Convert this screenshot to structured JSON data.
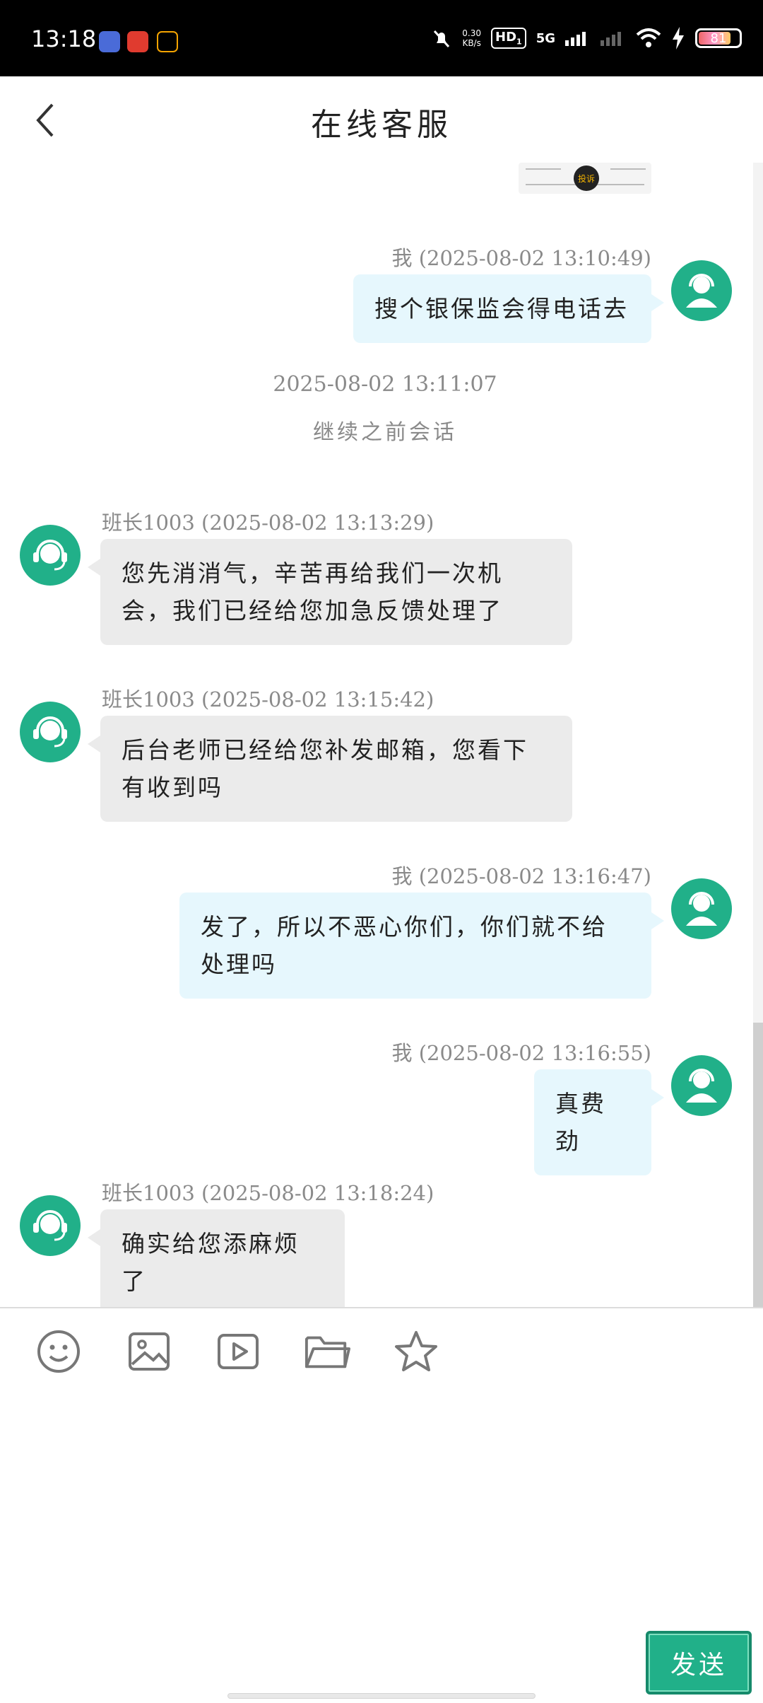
{
  "status_bar": {
    "time": "13:18",
    "net_speed_value": "0.30",
    "net_speed_unit": "KB/s",
    "hd_label": "HD",
    "hd_sub": "1",
    "network": "5G",
    "battery": "81"
  },
  "header": {
    "title": "在线客服",
    "back_icon": "chevron-left-icon"
  },
  "preview": {
    "button_label": "投诉"
  },
  "messages": [
    {
      "sender": "me",
      "meta": "我 (2025-08-02 13:10:49)",
      "text": [
        "搜个银保监会得电话去"
      ]
    },
    {
      "sender": "system",
      "timestamp": "2025-08-02 13:11:07",
      "note": "继续之前会话"
    },
    {
      "sender": "agent",
      "meta": "班长1003 (2025-08-02 13:13:29)",
      "text": [
        "您先消消气，辛苦再给我们一次机",
        "会，我们已经给您加急反馈处理了"
      ]
    },
    {
      "sender": "agent",
      "meta": "班长1003 (2025-08-02 13:15:42)",
      "text": [
        "后台老师已经给您补发邮箱，您看下",
        "有收到吗"
      ]
    },
    {
      "sender": "me",
      "meta": "我 (2025-08-02 13:16:47)",
      "text": [
        "发了，所以不恶心你们，你们就不给",
        "处理吗"
      ]
    },
    {
      "sender": "me",
      "meta": "我 (2025-08-02 13:16:55)",
      "text": [
        "真费劲"
      ]
    },
    {
      "sender": "agent",
      "meta": "班长1003 (2025-08-02 13:18:24)",
      "text": [
        "确实给您添麻烦了"
      ]
    }
  ],
  "toolbar": {
    "icons": [
      "emoji-icon",
      "image-icon",
      "video-icon",
      "folder-icon",
      "star-icon"
    ]
  },
  "send_button": {
    "label": "发送"
  },
  "colors": {
    "accent": "#21b089",
    "my_bubble": "#e6f7fd",
    "agent_bubble": "#ebebeb",
    "meta_text": "#8a8a8a"
  }
}
